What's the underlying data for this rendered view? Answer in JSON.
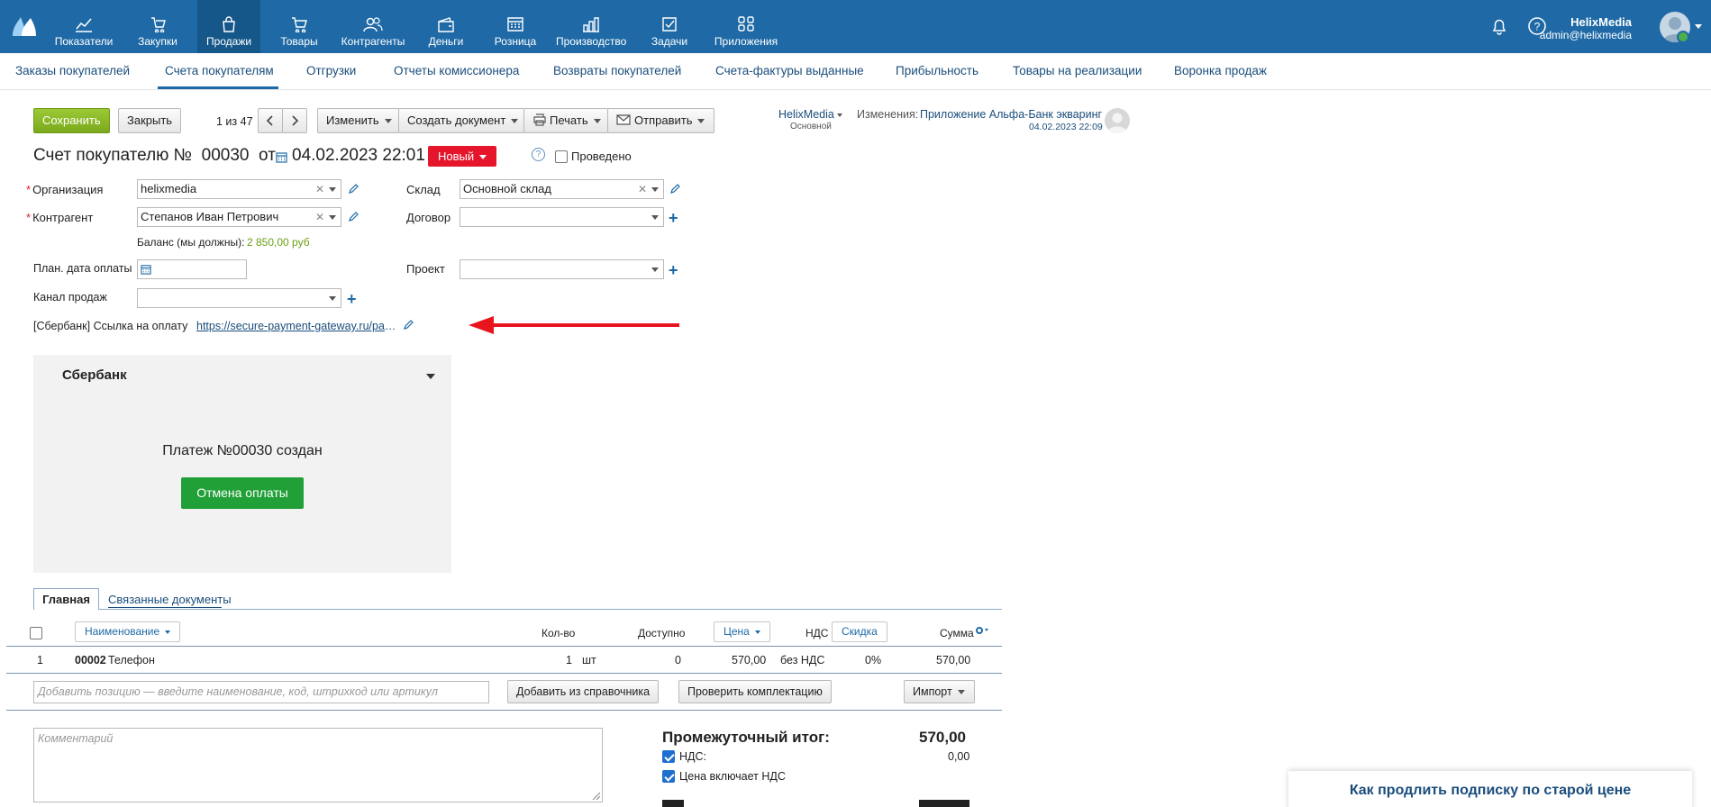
{
  "nav": {
    "items": [
      {
        "label": "Показатели",
        "icon": "chart-line-icon"
      },
      {
        "label": "Закупки",
        "icon": "cart-down-icon"
      },
      {
        "label": "Продажи",
        "icon": "bag-icon"
      },
      {
        "label": "Товары",
        "icon": "cart-icon"
      },
      {
        "label": "Контрагенты",
        "icon": "people-icon"
      },
      {
        "label": "Деньги",
        "icon": "wallet-icon"
      },
      {
        "label": "Розница",
        "icon": "register-icon"
      },
      {
        "label": "Производство",
        "icon": "factory-icon"
      },
      {
        "label": "Задачи",
        "icon": "checkbox-icon"
      },
      {
        "label": "Приложения",
        "icon": "apps-icon"
      }
    ],
    "active": "Продажи"
  },
  "user": {
    "name": "HelixMedia",
    "email": "admin@helixmedia"
  },
  "subnav": [
    "Заказы покупателей",
    "Счета покупателям",
    "Отгрузки",
    "Отчеты комиссионера",
    "Возвраты покупателей",
    "Счета-фактуры выданные",
    "Прибыльность",
    "Товары на реализации",
    "Воронка продаж"
  ],
  "toolbar": {
    "save": "Сохранить",
    "close": "Закрыть",
    "pager": "1 из 47",
    "edit": "Изменить",
    "create_doc": "Создать документ",
    "print": "Печать",
    "send": "Отправить"
  },
  "owner": {
    "name": "HelixMedia",
    "sub": "Основной"
  },
  "changes": {
    "label": "Изменения:",
    "value": "Приложение Альфа-Банк экваринг",
    "date": "04.02.2023 22:09"
  },
  "doc": {
    "title_prefix": "Счет покупателю №",
    "number": "00030",
    "from": "от",
    "date": "04.02.2023 22:01",
    "status": "Новый",
    "posted_label": "Проведено"
  },
  "form": {
    "org_label": "Организация",
    "org_value": "helixmedia",
    "warehouse_label": "Склад",
    "warehouse_value": "Основной склад",
    "counterparty_label": "Контрагент",
    "counterparty_value": "Степанов Иван Петрович",
    "contract_label": "Договор",
    "balance_label": "Баланс (мы должны):",
    "balance_value": "2 850,00 руб",
    "pay_date_label": "План. дата оплаты",
    "project_label": "Проект",
    "channel_label": "Канал продаж",
    "link_label": "[Сбербанк] Ссылка на оплату",
    "link_value": "https://secure-payment-gateway.ru/pay..."
  },
  "sber": {
    "title": "Сбербанк",
    "message": "Платеж №00030 создан",
    "cancel": "Отмена оплаты"
  },
  "tabs": {
    "main": "Главная",
    "related": "Связанные документы"
  },
  "table": {
    "headers": {
      "name": "Наименование",
      "qty": "Кол-во",
      "available": "Доступно",
      "price": "Цена",
      "vat": "НДС",
      "discount": "Скидка",
      "sum": "Сумма"
    },
    "rows": [
      {
        "n": "1",
        "code": "00002",
        "name": "Телефон",
        "qty": "1",
        "unit": "шт",
        "available": "0",
        "price": "570,00",
        "vat": "без НДС",
        "discount": "0%",
        "sum": "570,00"
      }
    ],
    "add_placeholder": "Добавить позицию — введите наименование, код, штрихкод или артикул",
    "add_from_catalog": "Добавить из справочника",
    "check_set": "Проверить комплектацию",
    "import": "Импорт"
  },
  "comment_placeholder": "Комментарий",
  "totals": {
    "subtotal_label": "Промежуточный итог:",
    "subtotal_value": "570,00",
    "vat_label": "НДС:",
    "vat_value": "0,00",
    "price_incl_vat": "Цена включает НДС"
  },
  "promo": "Как продлить подписку по старой цене",
  "colors": {
    "nav": "#1f6aa6",
    "save": "#8cba2a",
    "status": "#e5162b",
    "sber_button": "#21a038",
    "arrow": "#e8141e"
  }
}
